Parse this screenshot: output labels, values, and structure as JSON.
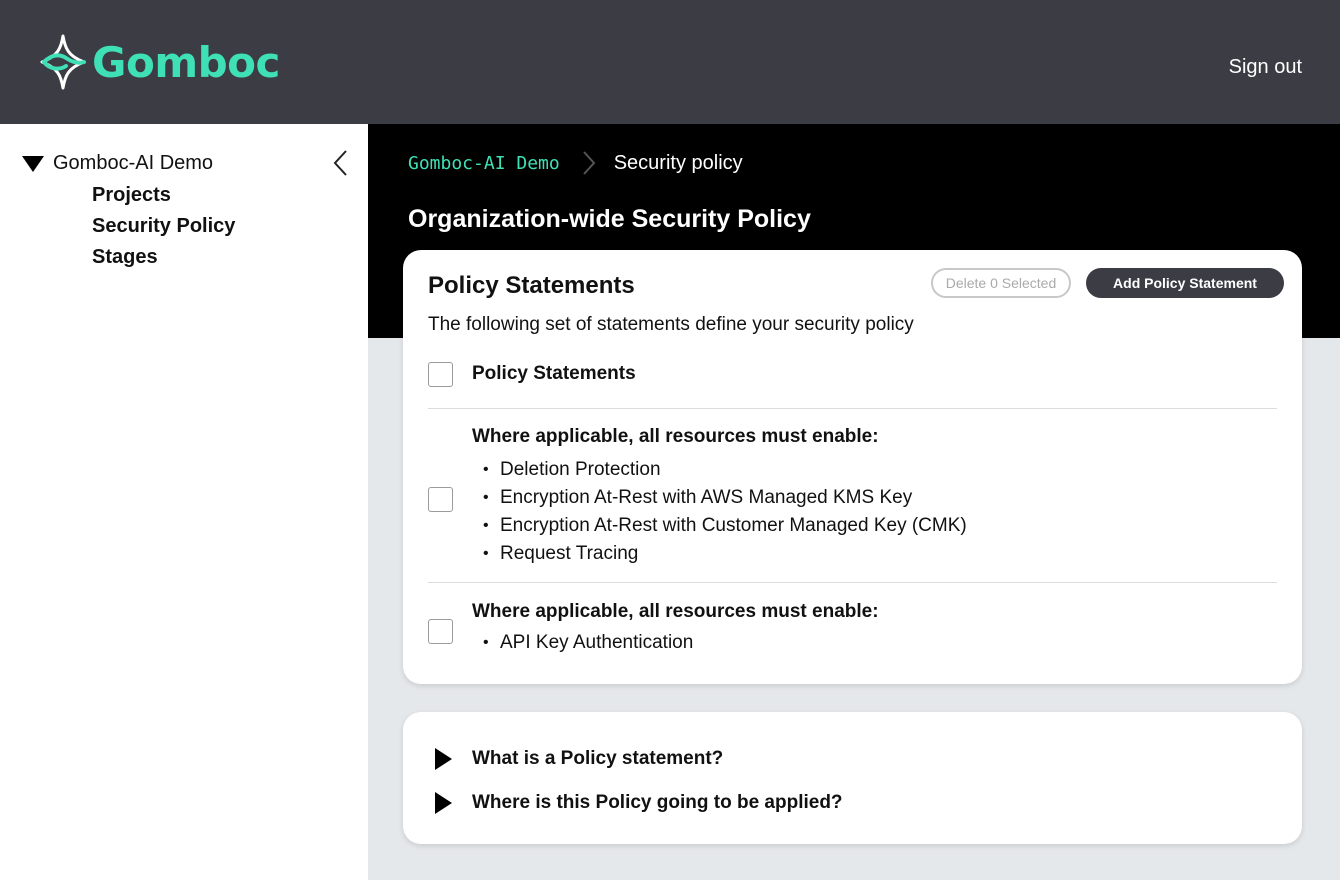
{
  "header": {
    "brand": "Gomboc",
    "signout_label": "Sign out",
    "brand_color": "#3fe0b5",
    "bg_color": "#3b3c44"
  },
  "sidebar": {
    "org_name": "Gomboc-AI Demo",
    "items": [
      {
        "label": "Projects"
      },
      {
        "label": "Security Policy"
      },
      {
        "label": "Stages"
      }
    ]
  },
  "breadcrumb": {
    "root": "Gomboc-AI Demo",
    "current": "Security policy"
  },
  "page_title": "Organization-wide Security Policy",
  "policy_card": {
    "title": "Policy Statements",
    "description": "The following set of statements define your security policy",
    "delete_label": "Delete 0 Selected",
    "add_label": "Add Policy Statement",
    "column_header": "Policy Statements",
    "statements": [
      {
        "heading": "Where applicable, all resources must enable:",
        "items": [
          "Deletion Protection",
          "Encryption At-Rest with AWS Managed KMS Key",
          "Encryption At-Rest with Customer Managed Key (CMK)",
          "Request Tracing"
        ]
      },
      {
        "heading": "Where applicable, all resources must enable:",
        "items": [
          "API Key Authentication"
        ]
      }
    ]
  },
  "faq": [
    {
      "question": "What is a Policy statement?"
    },
    {
      "question": "Where is this Policy going to be applied?"
    }
  ]
}
